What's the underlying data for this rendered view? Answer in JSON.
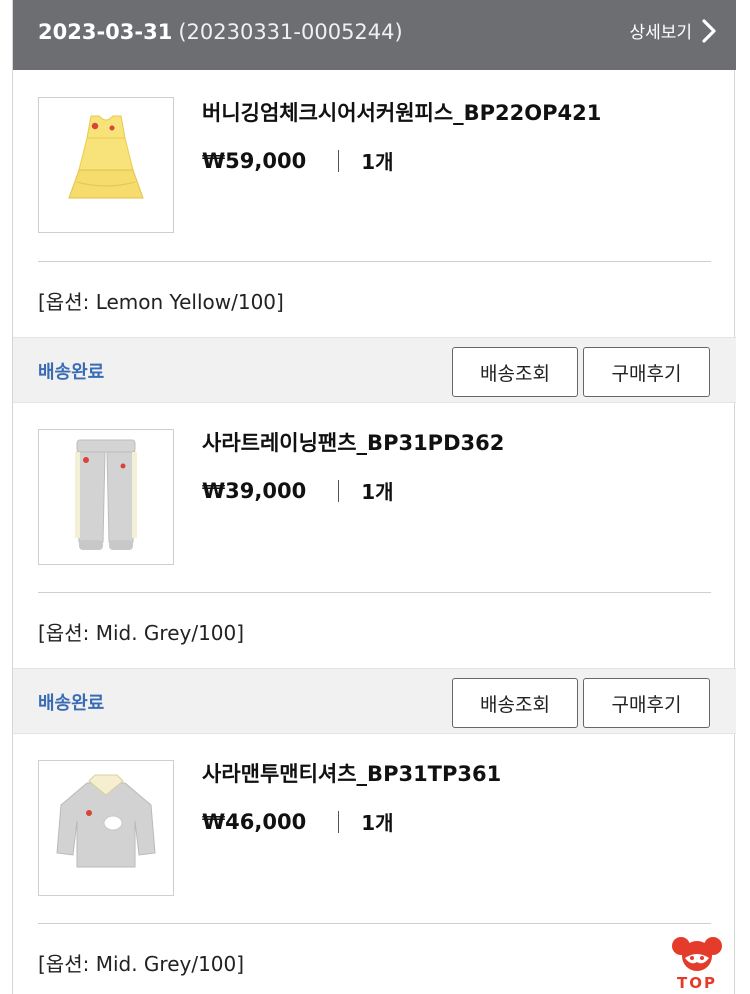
{
  "order": {
    "date": "2023-03-31",
    "number": "(20230331-0005244)",
    "detail_label": "상세보기"
  },
  "items": [
    {
      "name": "버니깅엄체크시어서커원피스_BP22OP421",
      "price": "₩59,000",
      "quantity": "1개",
      "option": "[옵션: Lemon Yellow/100]",
      "status": "배송완료",
      "track_label": "배송조회",
      "review_label": "구매후기",
      "image_icon": "yellow-dress-icon"
    },
    {
      "name": "사라트레이닝팬츠_BP31PD362",
      "price": "₩39,000",
      "quantity": "1개",
      "option": "[옵션: Mid. Grey/100]",
      "status": "배송완료",
      "track_label": "배송조회",
      "review_label": "구매후기",
      "image_icon": "grey-pants-icon"
    },
    {
      "name": "사라맨투맨티셔츠_BP31TP361",
      "price": "₩46,000",
      "quantity": "1개",
      "option": "[옵션: Mid. Grey/100]",
      "image_icon": "grey-sweatshirt-icon"
    }
  ],
  "top_button": {
    "label": "TOP",
    "icon": "bear-mascot-icon"
  },
  "colors": {
    "header_bg": "#6d6e72",
    "status_text": "#3a6cb5",
    "status_bar_bg": "#f1f1f1",
    "top_accent": "#e53b2a"
  }
}
